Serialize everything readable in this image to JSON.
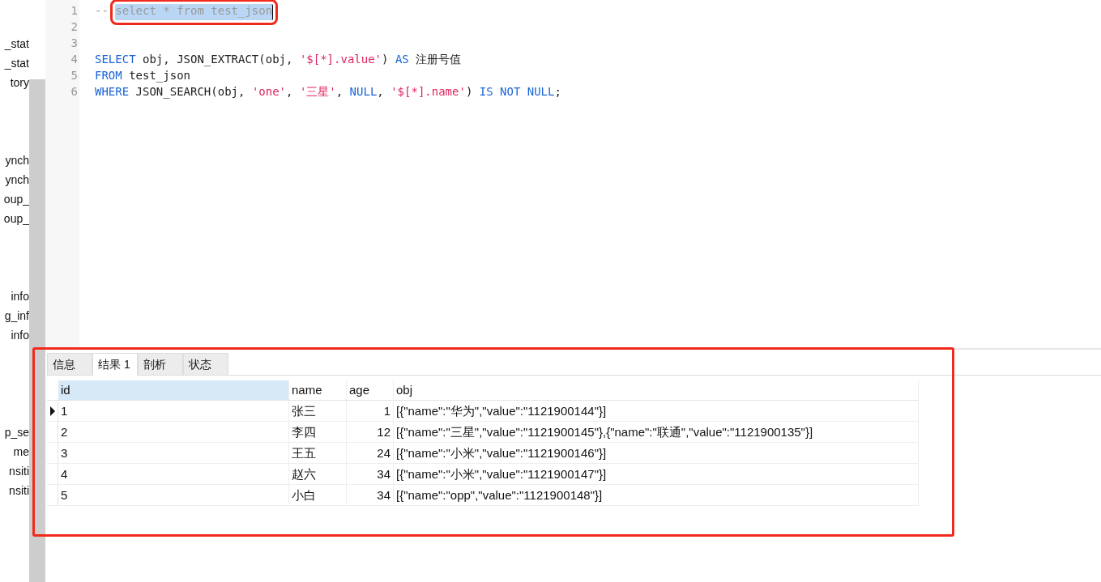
{
  "sidebar": {
    "groups": [
      {
        "items": [
          "_stat",
          "_stat",
          "tory"
        ]
      },
      {
        "items": [
          "ynch",
          "ynch",
          "oup_",
          "oup_"
        ]
      },
      {
        "items": [
          "info",
          "g_inf",
          "info"
        ]
      },
      {
        "items": [
          "p_se",
          "me",
          "nsiti",
          "nsiti"
        ]
      }
    ]
  },
  "editor": {
    "lines": [
      {
        "number": "1",
        "tokens": [
          {
            "kind": "comment",
            "text": "-- "
          },
          {
            "kind": "selected",
            "text": "select * from test_json"
          }
        ]
      },
      {
        "number": "2"
      },
      {
        "number": "3"
      },
      {
        "number": "4",
        "tokens": [
          {
            "kind": "keyword",
            "text": "SELECT"
          },
          {
            "kind": "plain",
            "text": " obj, JSON_EXTRACT(obj, "
          },
          {
            "kind": "string",
            "text": "'$[*].value'"
          },
          {
            "kind": "plain",
            "text": ") "
          },
          {
            "kind": "keyword",
            "text": "AS"
          },
          {
            "kind": "plain",
            "text": " 注册号值"
          }
        ]
      },
      {
        "number": "5",
        "tokens": [
          {
            "kind": "keyword",
            "text": "FROM"
          },
          {
            "kind": "plain",
            "text": " test_json"
          }
        ]
      },
      {
        "number": "6",
        "tokens": [
          {
            "kind": "keyword",
            "text": "WHERE"
          },
          {
            "kind": "plain",
            "text": " JSON_SEARCH(obj, "
          },
          {
            "kind": "string",
            "text": "'one'"
          },
          {
            "kind": "plain",
            "text": ", "
          },
          {
            "kind": "string",
            "text": "'三星'"
          },
          {
            "kind": "plain",
            "text": ", "
          },
          {
            "kind": "keyword",
            "text": "NULL"
          },
          {
            "kind": "plain",
            "text": ", "
          },
          {
            "kind": "string",
            "text": "'$[*].name'"
          },
          {
            "kind": "plain",
            "text": ") "
          },
          {
            "kind": "keyword",
            "text": "IS NOT NULL"
          },
          {
            "kind": "plain",
            "text": ";"
          }
        ]
      }
    ]
  },
  "results": {
    "tabs": [
      {
        "label": "信息",
        "selected": false
      },
      {
        "label": "结果 1",
        "selected": true
      },
      {
        "label": "剖析",
        "selected": false
      },
      {
        "label": "状态",
        "selected": false
      }
    ],
    "table": {
      "columns": [
        {
          "label": "id",
          "selected": true
        },
        {
          "label": "name",
          "selected": false
        },
        {
          "label": "age",
          "selected": false
        },
        {
          "label": "obj",
          "selected": false
        }
      ],
      "rows": [
        {
          "current": true,
          "cells": [
            "1",
            "张三",
            "1",
            "[{\"name\":\"华为\",\"value\":\"1121900144\"}]"
          ]
        },
        {
          "current": false,
          "cells": [
            "2",
            "李四",
            "12",
            "[{\"name\":\"三星\",\"value\":\"1121900145\"},{\"name\":\"联通\",\"value\":\"1121900135\"}]"
          ]
        },
        {
          "current": false,
          "cells": [
            "3",
            "王五",
            "24",
            "[{\"name\":\"小米\",\"value\":\"1121900146\"}]"
          ]
        },
        {
          "current": false,
          "cells": [
            "4",
            "赵六",
            "34",
            "[{\"name\":\"小米\",\"value\":\"1121900147\"}]"
          ]
        },
        {
          "current": false,
          "cells": [
            "5",
            "小白",
            "34",
            "[{\"name\":\"opp\",\"value\":\"1121900148\"}]"
          ]
        }
      ]
    }
  }
}
